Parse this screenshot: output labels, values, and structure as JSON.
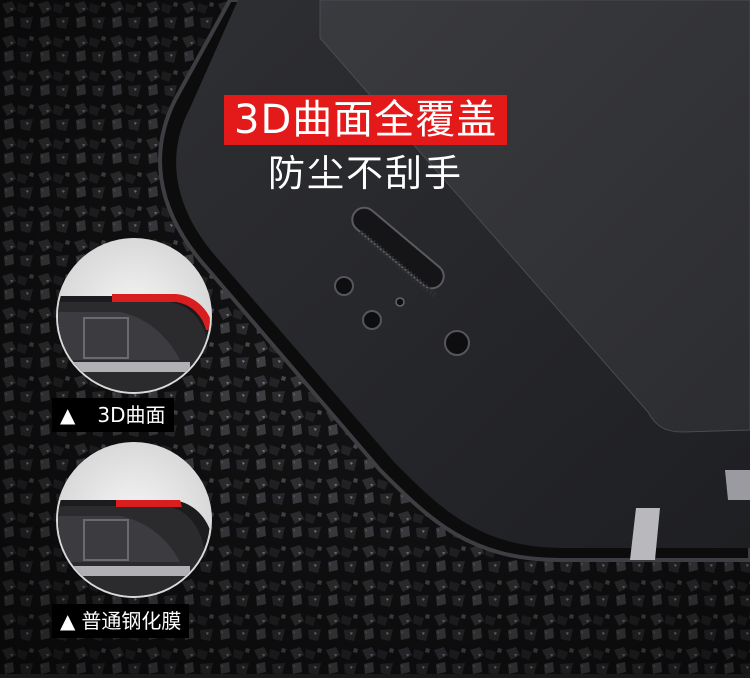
{
  "headline": "3D曲面全覆盖",
  "subline": "防尘不刮手",
  "captions": [
    {
      "marker": "▲",
      "text": "3D曲面"
    },
    {
      "marker": "▲",
      "text": "普通钢化膜"
    }
  ],
  "colors": {
    "headline_bg": "#e41a1a",
    "caption_bg": "#000000",
    "text": "#ffffff",
    "accent_red": "#d81e1e"
  }
}
